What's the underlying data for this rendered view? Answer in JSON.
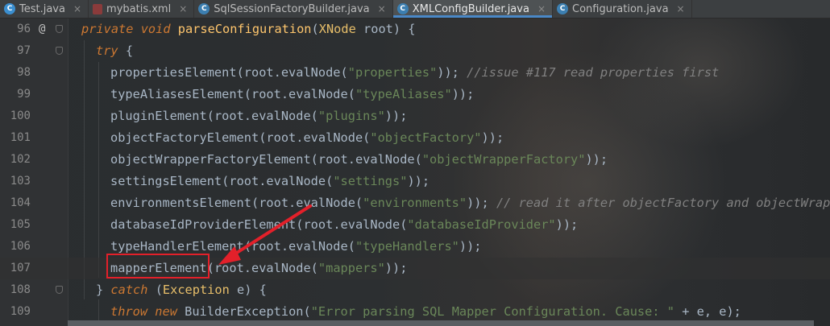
{
  "tabs": [
    {
      "label": "Test.java",
      "icon": "java-class-icon",
      "active": false
    },
    {
      "label": "mybatis.xml",
      "icon": "xml-file-icon",
      "active": false
    },
    {
      "label": "SqlSessionFactoryBuilder.java",
      "icon": "java-class-icon",
      "active": false
    },
    {
      "label": "XMLConfigBuilder.java",
      "icon": "java-class-icon",
      "active": true
    },
    {
      "label": "Configuration.java",
      "icon": "java-class-icon",
      "active": false
    }
  ],
  "close_glyph": "×",
  "editor": {
    "lines": [
      {
        "no": "96",
        "marker": "@"
      },
      {
        "no": "97"
      },
      {
        "no": "98"
      },
      {
        "no": "99"
      },
      {
        "no": "100"
      },
      {
        "no": "101"
      },
      {
        "no": "102"
      },
      {
        "no": "103"
      },
      {
        "no": "104"
      },
      {
        "no": "105"
      },
      {
        "no": "106"
      },
      {
        "no": "107",
        "current": true
      },
      {
        "no": "108"
      },
      {
        "no": "109"
      }
    ],
    "code": {
      "l96": {
        "kw1": "private",
        "kw2": "void",
        "fn": "parseConfiguration",
        "open": "(",
        "type": "XNode",
        "param": "root",
        "close": ") {"
      },
      "l97": {
        "kw": "try",
        "brace": " {"
      },
      "l98": {
        "call": "propertiesElement",
        "root": "root",
        "eval": ".evalNode(",
        "str": "\"properties\"",
        "end": "));",
        "comment": "//issue #117 read properties first"
      },
      "l99": {
        "call": "typeAliasesElement",
        "root": "root",
        "eval": ".evalNode(",
        "str": "\"typeAliases\"",
        "end": "));"
      },
      "l100": {
        "call": "pluginElement",
        "root": "root",
        "eval": ".evalNode(",
        "str": "\"plugins\"",
        "end": "));"
      },
      "l101": {
        "call": "objectFactoryElement",
        "root": "root",
        "eval": ".evalNode(",
        "str": "\"objectFactory\"",
        "end": "));"
      },
      "l102": {
        "call": "objectWrapperFactoryElement",
        "root": "root",
        "eval": ".evalNode(",
        "str": "\"objectWrapperFactory\"",
        "end": "));"
      },
      "l103": {
        "call": "settingsElement",
        "root": "root",
        "eval": ".evalNode(",
        "str": "\"settings\"",
        "end": "));"
      },
      "l104": {
        "call": "environmentsElement",
        "root": "root",
        "eval": ".evalNode(",
        "str": "\"environments\"",
        "end": "));",
        "comment": "// read it after objectFactory and objectWrapper"
      },
      "l105": {
        "call": "databaseIdProviderElement",
        "root": "root",
        "eval": ".evalNode(",
        "str": "\"databaseIdProvider\"",
        "end": "));"
      },
      "l106": {
        "call": "typeHandlerElement",
        "root": "root",
        "eval": ".evalNode(",
        "str": "\"typeHandlers\"",
        "end": "));"
      },
      "l107": {
        "call": "mapperElement",
        "root": "root",
        "eval": ".evalNode(",
        "str": "\"mappers\"",
        "end": "));"
      },
      "l108": {
        "brace": "} ",
        "kw": "catch",
        "open": " (",
        "type": "Exception",
        "var": " e",
        "close": ") {"
      },
      "l109": {
        "kw1": "throw",
        "kw2": "new",
        "cls": "BuilderException",
        "open": "(",
        "str": "\"Error parsing SQL Mapper Configuration. Cause: \"",
        "plus": " + e, e);"
      }
    }
  },
  "annotation": {
    "color": "#e3202a"
  }
}
